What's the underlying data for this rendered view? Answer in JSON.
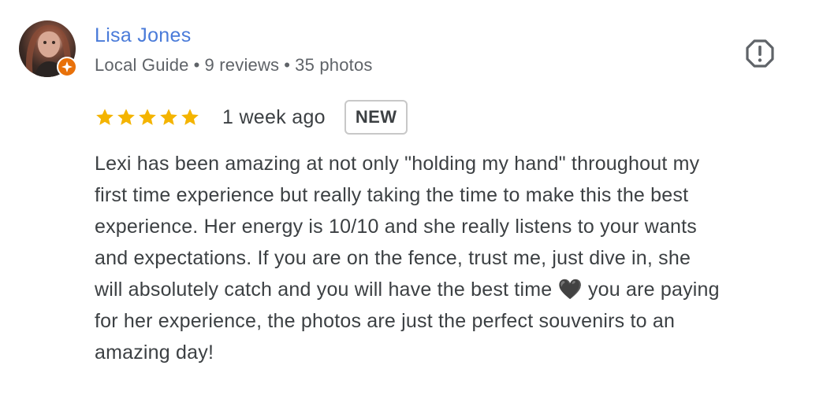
{
  "reviewer": {
    "name": "Lisa Jones",
    "level": "Local Guide",
    "reviews": "9 reviews",
    "photos": "35 photos",
    "separator": "•"
  },
  "rating": {
    "stars": 5,
    "max": 5,
    "star_color": "#f4b400",
    "time": "1 week ago",
    "badge": "NEW"
  },
  "review_lines": [
    "Lexi has been amazing at not only \"holding my hand\" throughout my",
    "first time experience but really taking the time to make this the best",
    "experience. Her energy is 10/10 and she really listens to your wants",
    "and expectations. If you are on the fence, trust me, just dive in, she",
    "will absolutely catch and you will have the best time 🖤 you are paying",
    "for her experience, the photos are just the perfect souvenirs to an",
    "amazing day!"
  ],
  "icons": {
    "report": "report-flag-icon",
    "guide_badge": "local-guide-star-icon"
  },
  "colors": {
    "name": "#4a7bd9",
    "meta": "#5f6368",
    "text": "#3c4043",
    "guide_badge": "#e8710a"
  }
}
